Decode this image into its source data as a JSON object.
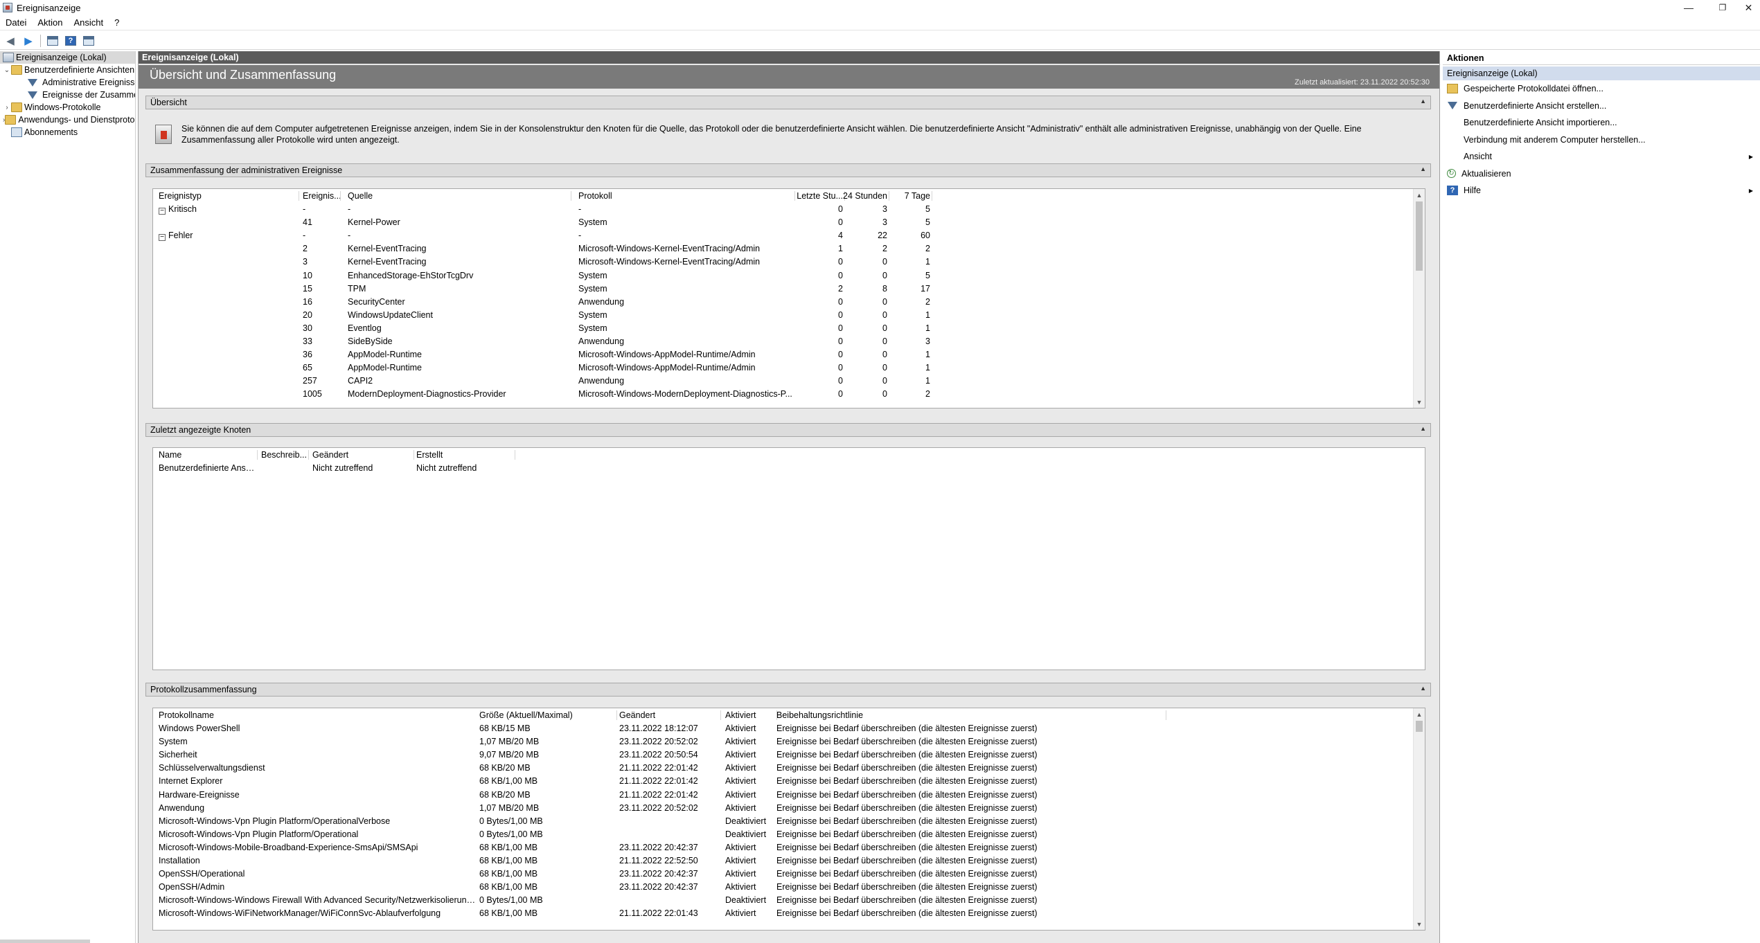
{
  "window": {
    "title": "Ereignisanzeige",
    "controls": {
      "minimize": "—",
      "restore": "❐",
      "close": "✕"
    }
  },
  "menu": [
    "Datei",
    "Aktion",
    "Ansicht",
    "?"
  ],
  "toolbar": {
    "icons": [
      "back-arrow-icon",
      "forward-arrow-icon",
      "show-hide-console-tree-icon",
      "help-icon",
      "show-hide-action-pane-icon"
    ],
    "help_glyph": "?"
  },
  "tree": {
    "items": [
      {
        "label": "Ereignisanzeige (Lokal)",
        "toggle": "",
        "indent": 0,
        "icon": "event-viewer-icon",
        "selected": true
      },
      {
        "label": "Benutzerdefinierte Ansichten",
        "toggle": "⌄",
        "indent": 1,
        "icon": "folder-icon"
      },
      {
        "label": "Administrative Ereignisse",
        "toggle": "",
        "indent": 2,
        "icon": "filter-icon"
      },
      {
        "label": "Ereignisse der Zusammenfassung",
        "toggle": "",
        "indent": 2,
        "icon": "filter-icon"
      },
      {
        "label": "Windows-Protokolle",
        "toggle": "›",
        "indent": 1,
        "icon": "folder-icon"
      },
      {
        "label": "Anwendungs- und Dienstprotokolle",
        "toggle": "›",
        "indent": 1,
        "icon": "folder-icon"
      },
      {
        "label": "Abonnements",
        "toggle": "",
        "indent": 1,
        "icon": "subscriptions-icon"
      }
    ]
  },
  "center": {
    "header": "Ereignisanzeige (Lokal)",
    "overview_title": "Übersicht und Zusammenfassung",
    "last_updated": "Zuletzt aktualisiert: 23.11.2022 20:52:30",
    "collapse_glyph": "▲",
    "scroll_up": "▲",
    "scroll_down": "▼",
    "overview": {
      "heading": "Übersicht",
      "description": "Sie können die auf dem Computer aufgetretenen Ereignisse anzeigen, indem Sie in der Konsolenstruktur den Knoten für die Quelle, das Protokoll oder die benutzerdefinierte Ansicht wählen. Die benutzerdefinierte Ansicht \"Administrativ\" enthält alle administrativen Ereignisse, unabhängig von der Quelle. Eine Zusammenfassung aller Protokolle wird unten angezeigt."
    },
    "admin_summary": {
      "heading": "Zusammenfassung der administrativen Ereignisse",
      "columns": [
        "Ereignistyp",
        "Ereignis...",
        "Quelle",
        "Protokoll",
        "Letzte Stu...",
        "24 Stunden",
        "7 Tage"
      ],
      "rows": [
        {
          "type": "Kritisch",
          "expander": "−",
          "id": "-",
          "source": "-",
          "log": "-",
          "hour": "0",
          "day": "3",
          "week": "5"
        },
        {
          "type": "",
          "expander": "",
          "id": "41",
          "source": "Kernel-Power",
          "log": "System",
          "hour": "0",
          "day": "3",
          "week": "5"
        },
        {
          "type": "Fehler",
          "expander": "−",
          "id": "-",
          "source": "-",
          "log": "-",
          "hour": "4",
          "day": "22",
          "week": "60"
        },
        {
          "type": "",
          "expander": "",
          "id": "2",
          "source": "Kernel-EventTracing",
          "log": "Microsoft-Windows-Kernel-EventTracing/Admin",
          "hour": "1",
          "day": "2",
          "week": "2"
        },
        {
          "type": "",
          "expander": "",
          "id": "3",
          "source": "Kernel-EventTracing",
          "log": "Microsoft-Windows-Kernel-EventTracing/Admin",
          "hour": "0",
          "day": "0",
          "week": "1"
        },
        {
          "type": "",
          "expander": "",
          "id": "10",
          "source": "EnhancedStorage-EhStorTcgDrv",
          "log": "System",
          "hour": "0",
          "day": "0",
          "week": "5"
        },
        {
          "type": "",
          "expander": "",
          "id": "15",
          "source": "TPM",
          "log": "System",
          "hour": "2",
          "day": "8",
          "week": "17"
        },
        {
          "type": "",
          "expander": "",
          "id": "16",
          "source": "SecurityCenter",
          "log": "Anwendung",
          "hour": "0",
          "day": "0",
          "week": "2"
        },
        {
          "type": "",
          "expander": "",
          "id": "20",
          "source": "WindowsUpdateClient",
          "log": "System",
          "hour": "0",
          "day": "0",
          "week": "1"
        },
        {
          "type": "",
          "expander": "",
          "id": "30",
          "source": "Eventlog",
          "log": "System",
          "hour": "0",
          "day": "0",
          "week": "1"
        },
        {
          "type": "",
          "expander": "",
          "id": "33",
          "source": "SideBySide",
          "log": "Anwendung",
          "hour": "0",
          "day": "0",
          "week": "3"
        },
        {
          "type": "",
          "expander": "",
          "id": "36",
          "source": "AppModel-Runtime",
          "log": "Microsoft-Windows-AppModel-Runtime/Admin",
          "hour": "0",
          "day": "0",
          "week": "1"
        },
        {
          "type": "",
          "expander": "",
          "id": "65",
          "source": "AppModel-Runtime",
          "log": "Microsoft-Windows-AppModel-Runtime/Admin",
          "hour": "0",
          "day": "0",
          "week": "1"
        },
        {
          "type": "",
          "expander": "",
          "id": "257",
          "source": "CAPI2",
          "log": "Anwendung",
          "hour": "0",
          "day": "0",
          "week": "1"
        },
        {
          "type": "",
          "expander": "",
          "id": "1005",
          "source": "ModernDeployment-Diagnostics-Provider",
          "log": "Microsoft-Windows-ModernDeployment-Diagnostics-P...",
          "hour": "0",
          "day": "0",
          "week": "2"
        }
      ]
    },
    "recent_nodes": {
      "heading": "Zuletzt angezeigte Knoten",
      "columns": [
        "Name",
        "Beschreib...",
        "Geändert",
        "Erstellt"
      ],
      "rows": [
        {
          "name": "Benutzerdefinierte Ansic...",
          "desc": "",
          "changed": "Nicht zutreffend",
          "created": "Nicht zutreffend"
        }
      ]
    },
    "log_summary": {
      "heading": "Protokollzusammenfassung",
      "columns": [
        "Protokollname",
        "Größe (Aktuell/Maximal)",
        "Geändert",
        "Aktiviert",
        "Beibehaltungsrichtlinie"
      ],
      "rows": [
        {
          "name": "Windows PowerShell",
          "size": "68 KB/15 MB",
          "changed": "23.11.2022 18:12:07",
          "enabled": "Aktiviert",
          "policy": "Ereignisse bei Bedarf überschreiben (die ältesten Ereignisse zuerst)"
        },
        {
          "name": "System",
          "size": "1,07 MB/20 MB",
          "changed": "23.11.2022 20:52:02",
          "enabled": "Aktiviert",
          "policy": "Ereignisse bei Bedarf überschreiben (die ältesten Ereignisse zuerst)"
        },
        {
          "name": "Sicherheit",
          "size": "9,07 MB/20 MB",
          "changed": "23.11.2022 20:50:54",
          "enabled": "Aktiviert",
          "policy": "Ereignisse bei Bedarf überschreiben (die ältesten Ereignisse zuerst)"
        },
        {
          "name": "Schlüsselverwaltungsdienst",
          "size": "68 KB/20 MB",
          "changed": "21.11.2022 22:01:42",
          "enabled": "Aktiviert",
          "policy": "Ereignisse bei Bedarf überschreiben (die ältesten Ereignisse zuerst)"
        },
        {
          "name": "Internet Explorer",
          "size": "68 KB/1,00 MB",
          "changed": "21.11.2022 22:01:42",
          "enabled": "Aktiviert",
          "policy": "Ereignisse bei Bedarf überschreiben (die ältesten Ereignisse zuerst)"
        },
        {
          "name": "Hardware-Ereignisse",
          "size": "68 KB/20 MB",
          "changed": "21.11.2022 22:01:42",
          "enabled": "Aktiviert",
          "policy": "Ereignisse bei Bedarf überschreiben (die ältesten Ereignisse zuerst)"
        },
        {
          "name": "Anwendung",
          "size": "1,07 MB/20 MB",
          "changed": "23.11.2022 20:52:02",
          "enabled": "Aktiviert",
          "policy": "Ereignisse bei Bedarf überschreiben (die ältesten Ereignisse zuerst)"
        },
        {
          "name": "Microsoft-Windows-Vpn Plugin Platform/OperationalVerbose",
          "size": "0 Bytes/1,00 MB",
          "changed": "",
          "enabled": "Deaktiviert",
          "policy": "Ereignisse bei Bedarf überschreiben (die ältesten Ereignisse zuerst)"
        },
        {
          "name": "Microsoft-Windows-Vpn Plugin Platform/Operational",
          "size": "0 Bytes/1,00 MB",
          "changed": "",
          "enabled": "Deaktiviert",
          "policy": "Ereignisse bei Bedarf überschreiben (die ältesten Ereignisse zuerst)"
        },
        {
          "name": "Microsoft-Windows-Mobile-Broadband-Experience-SmsApi/SMSApi",
          "size": "68 KB/1,00 MB",
          "changed": "23.11.2022 20:42:37",
          "enabled": "Aktiviert",
          "policy": "Ereignisse bei Bedarf überschreiben (die ältesten Ereignisse zuerst)"
        },
        {
          "name": "Installation",
          "size": "68 KB/1,00 MB",
          "changed": "21.11.2022 22:52:50",
          "enabled": "Aktiviert",
          "policy": "Ereignisse bei Bedarf überschreiben (die ältesten Ereignisse zuerst)"
        },
        {
          "name": "OpenSSH/Operational",
          "size": "68 KB/1,00 MB",
          "changed": "23.11.2022 20:42:37",
          "enabled": "Aktiviert",
          "policy": "Ereignisse bei Bedarf überschreiben (die ältesten Ereignisse zuerst)"
        },
        {
          "name": "OpenSSH/Admin",
          "size": "68 KB/1,00 MB",
          "changed": "23.11.2022 20:42:37",
          "enabled": "Aktiviert",
          "policy": "Ereignisse bei Bedarf überschreiben (die ältesten Ereignisse zuerst)"
        },
        {
          "name": "Microsoft-Windows-Windows Firewall With Advanced Security/Netzwerkisolierung b...",
          "size": "0 Bytes/1,00 MB",
          "changed": "",
          "enabled": "Deaktiviert",
          "policy": "Ereignisse bei Bedarf überschreiben (die ältesten Ereignisse zuerst)"
        },
        {
          "name": "Microsoft-Windows-WiFiNetworkManager/WiFiConnSvc-Ablaufverfolgung",
          "size": "68 KB/1,00 MB",
          "changed": "21.11.2022 22:01:43",
          "enabled": "Aktiviert",
          "policy": "Ereignisse bei Bedarf überschreiben (die ältesten Ereignisse zuerst)"
        }
      ]
    }
  },
  "actions": {
    "heading": "Aktionen",
    "subheading": "Ereignisanzeige (Lokal)",
    "submenu_glyph": "▶",
    "items": [
      {
        "label": "Gespeicherte Protokolldatei öffnen...",
        "icon": "open-log-icon",
        "submenu": false
      },
      {
        "label": "Benutzerdefinierte Ansicht erstellen...",
        "icon": "filter-icon",
        "submenu": false
      },
      {
        "label": "Benutzerdefinierte Ansicht importieren...",
        "icon": "",
        "submenu": false
      },
      {
        "label": "Verbindung mit anderem Computer herstellen...",
        "icon": "",
        "submenu": false
      },
      {
        "label": "Ansicht",
        "icon": "",
        "submenu": true
      },
      {
        "label": "Aktualisieren",
        "icon": "refresh-icon",
        "submenu": false
      },
      {
        "label": "Hilfe",
        "icon": "help-icon",
        "submenu": true
      }
    ],
    "refresh_glyph": "↻",
    "help_glyph": "?"
  }
}
